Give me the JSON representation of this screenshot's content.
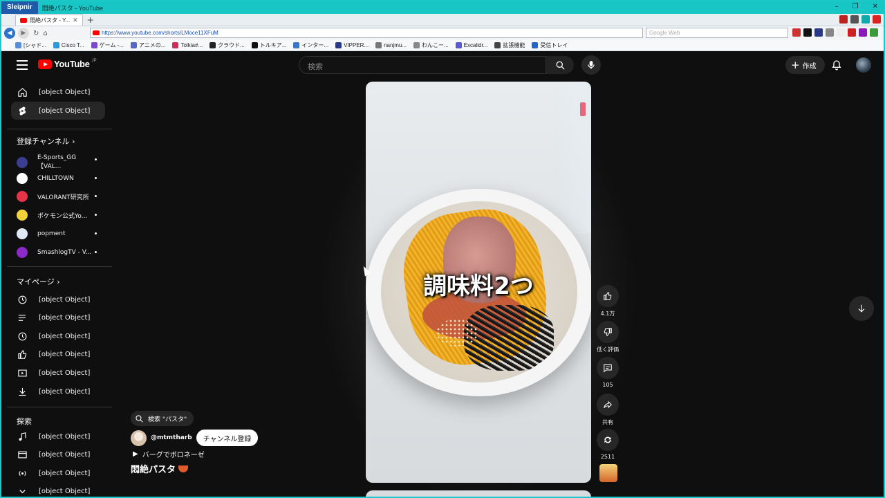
{
  "browser": {
    "brand": "Sleipnir",
    "window_title": "悶絶パスタ - YouTube",
    "tab_title": "悶絶パスタ - Y...",
    "url": "https://www.youtube.com/shorts/LMoce11XFuM",
    "search_placeholder": "Google Web",
    "bookmarks": [
      "[シャド...",
      "Cisco T...",
      "ゲーム -...",
      "アニメの...",
      "Tolkia#...",
      "クラウド...",
      "トルキア...",
      "インター...",
      "VIPPER...",
      "nanjmu...",
      "わんこー...",
      "Excalidr...",
      "拡張機能",
      "受信トレイ"
    ],
    "bookmark_colors": [
      "#5a8fd8",
      "#2b9be0",
      "#7a4bc8",
      "#5568c8",
      "#d12c5a",
      "#222222",
      "#111111",
      "#3a77c8",
      "#2a3a8a",
      "#777777",
      "#888888",
      "#5a5ad0",
      "#444444",
      "#2266cc"
    ]
  },
  "youtube": {
    "logo_text": "YouTube",
    "logo_region": "JP",
    "search_placeholder": "検索",
    "create_label": "作成",
    "sidebar": {
      "main": [
        {
          "label": "ホーム",
          "icon": "home-icon"
        },
        {
          "label": "ショート",
          "icon": "shorts-icon",
          "active": true
        }
      ],
      "subs_heading": "登録チャンネル",
      "subs": [
        {
          "label": "E-Sports_GG【VAL...",
          "color": "#3a3f8f"
        },
        {
          "label": "CHILLTOWN",
          "color": "#ffffff"
        },
        {
          "label": "VALORANT研究所",
          "color": "#e8344a"
        },
        {
          "label": "ポケモン公式Yo...",
          "color": "#f2d13a"
        },
        {
          "label": "popment",
          "color": "#dfe9f6"
        },
        {
          "label": "SmashlogTV - V...",
          "color": "#8a2ac8"
        }
      ],
      "you_heading": "マイページ",
      "you": [
        {
          "label": "履歴",
          "icon": "history-icon"
        },
        {
          "label": "再生リスト",
          "icon": "playlist-icon"
        },
        {
          "label": "後で見る",
          "icon": "watch-later-icon"
        },
        {
          "label": "高く評価した動画",
          "icon": "liked-icon"
        },
        {
          "label": "作成した動画",
          "icon": "your-videos-icon"
        },
        {
          "label": "オフライン",
          "icon": "download-icon"
        }
      ],
      "explore_heading": "探索",
      "explore": [
        {
          "label": "音楽",
          "icon": "music-icon"
        },
        {
          "label": "映画とテレビ",
          "icon": "movies-icon"
        },
        {
          "label": "ライブ",
          "icon": "live-icon"
        },
        {
          "label": "もっと見る",
          "icon": "chevron-down-icon"
        }
      ]
    },
    "short": {
      "caption": "調味料2つ",
      "search_chip": "検索 \"パスタ\"",
      "channel_handle": "@mtmtharb",
      "subscribe_label": "チャンネル登録",
      "music": "バーグでボロネーゼ",
      "title": "悶絶パスタ",
      "likes": "4.1万",
      "dislike_label": "低く評価",
      "comments": "105",
      "share_label": "共有",
      "remixes": "2511"
    }
  }
}
